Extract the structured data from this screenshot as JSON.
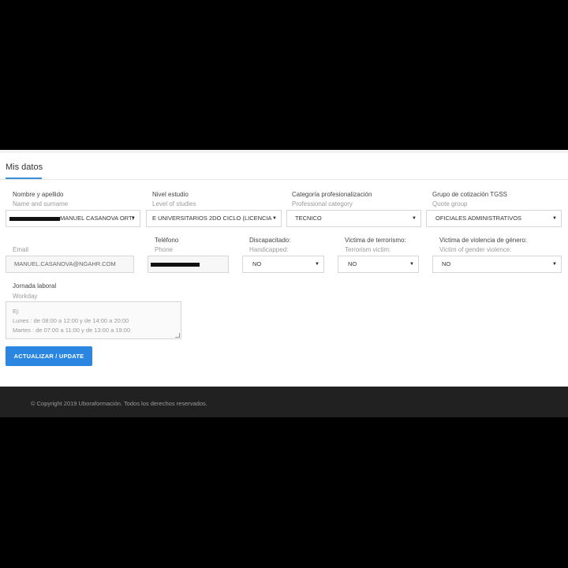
{
  "page": {
    "title": "Mis datos"
  },
  "fields": {
    "name": {
      "label": "Nombre y apellido",
      "sublabel": "Name and surname",
      "value": "MANUEL CASANOVA ORTI"
    },
    "studies": {
      "label": "Nivel estudio",
      "sublabel": "Level of studies",
      "value": "E UNIVERSITARIOS 2DO CICLO (LICENCIA"
    },
    "category": {
      "label": "Categoría profesionalización",
      "sublabel": "Professional category",
      "value": "TECNICO"
    },
    "quote_group": {
      "label": "Grupo de cotización TGSS",
      "sublabel": "Quote group",
      "value": "OFICIALES ADMINISTRATIVOS"
    },
    "email": {
      "label": "",
      "sublabel": "Email",
      "value": "MANUEL.CASANOVA@NGAHR.COM"
    },
    "phone": {
      "label": "Teléfono",
      "sublabel": "Phone",
      "value": ""
    },
    "handicapped": {
      "label": "Discapacitado:",
      "sublabel": "Handicapped:",
      "value": "NO"
    },
    "terrorism": {
      "label": "Victima de terrorismo:",
      "sublabel": "Terrorism victim:",
      "value": "NO"
    },
    "gender_violence": {
      "label": "Victima de violencia de género:",
      "sublabel": "Victim of gender violence:",
      "value": "NO"
    },
    "workday": {
      "label": "Jornada laboral",
      "sublabel": "Workday",
      "placeholder_lines": [
        "Ej:",
        "Lunes    : de 08:00 a 12:00 y de 14:00 a 20:00",
        "Martes : de 07:00 a 11:00 y de 13:00 a 19:00"
      ]
    }
  },
  "actions": {
    "update_label": "ACTUALIZAR / UPDATE"
  },
  "footer": {
    "text": "© Copyright 2019 Uboraformación. Todos los derechos reservados."
  },
  "icons": {
    "select_caret": "caret-down-icon"
  },
  "colors": {
    "accent": "#2a86e0",
    "footer_bg": "#212121"
  }
}
